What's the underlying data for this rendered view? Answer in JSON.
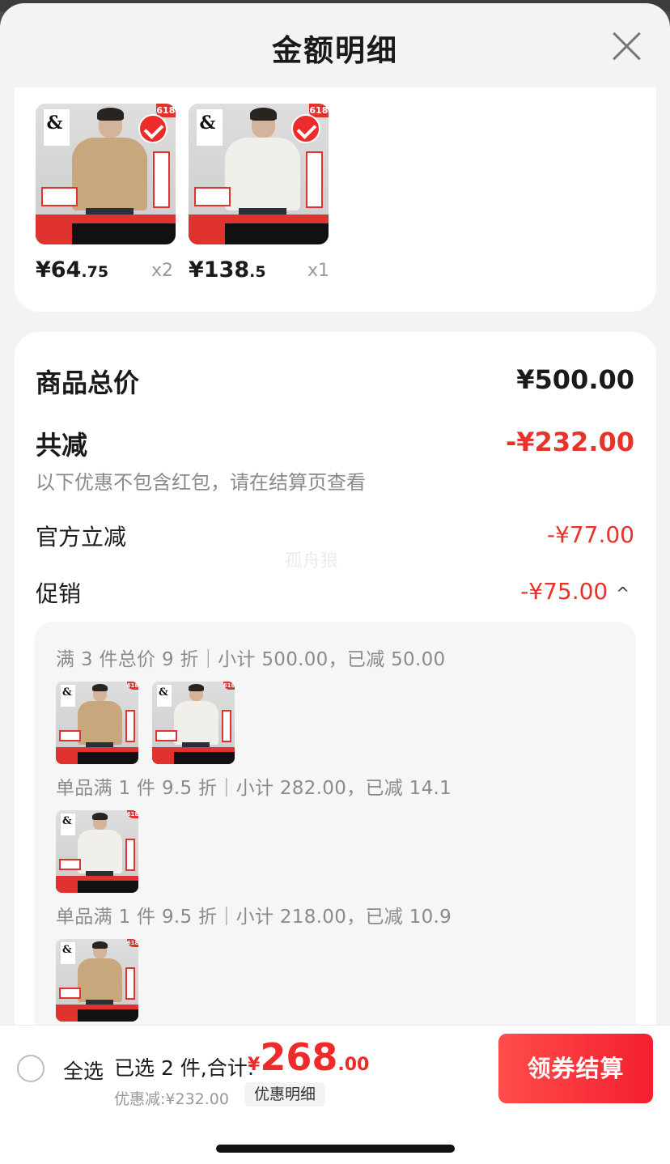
{
  "header": {
    "title": "金额明细"
  },
  "selected_products": [
    {
      "price_int": "¥64",
      "price_dec": ".75",
      "qty": "x2",
      "color": "khaki",
      "logo": "&",
      "badge": "618"
    },
    {
      "price_int": "¥138",
      "price_dec": ".5",
      "qty": "x1",
      "color": "white",
      "logo": "&",
      "badge": "618"
    }
  ],
  "summary": {
    "total_label": "商品总价",
    "total_value": "¥500.00",
    "reduce_label": "共减",
    "reduce_value": "-¥232.00",
    "reduce_note": "以下优惠不包含红包，请在结算页查看",
    "official_label": "官方立减",
    "official_value": "-¥77.00",
    "promo_label": "促销",
    "promo_value": "-¥75.00",
    "promo_caret": "^",
    "watermark": "孤舟狼"
  },
  "promotions": [
    {
      "text": "满 3 件总价 9 折｜小计 500.00，已减 50.00"
    },
    {
      "text": "单品满 1 件 9.5 折｜小计 282.00，已减 14.1"
    },
    {
      "text": "单品满 1 件 9.5 折｜小计 218.00，已减 10.9"
    }
  ],
  "bottom_bar": {
    "select_all": "全选",
    "selected_text": "已选 2 件,合计:",
    "currency": "¥",
    "total_int": "268",
    "total_dec": ".00",
    "discount_text": "优惠减:¥232.00",
    "detail_button": "优惠明细",
    "checkout_button": "领券结算"
  },
  "colors": {
    "accent_red": "#ee2b2b",
    "discount_red": "#e8332a"
  }
}
